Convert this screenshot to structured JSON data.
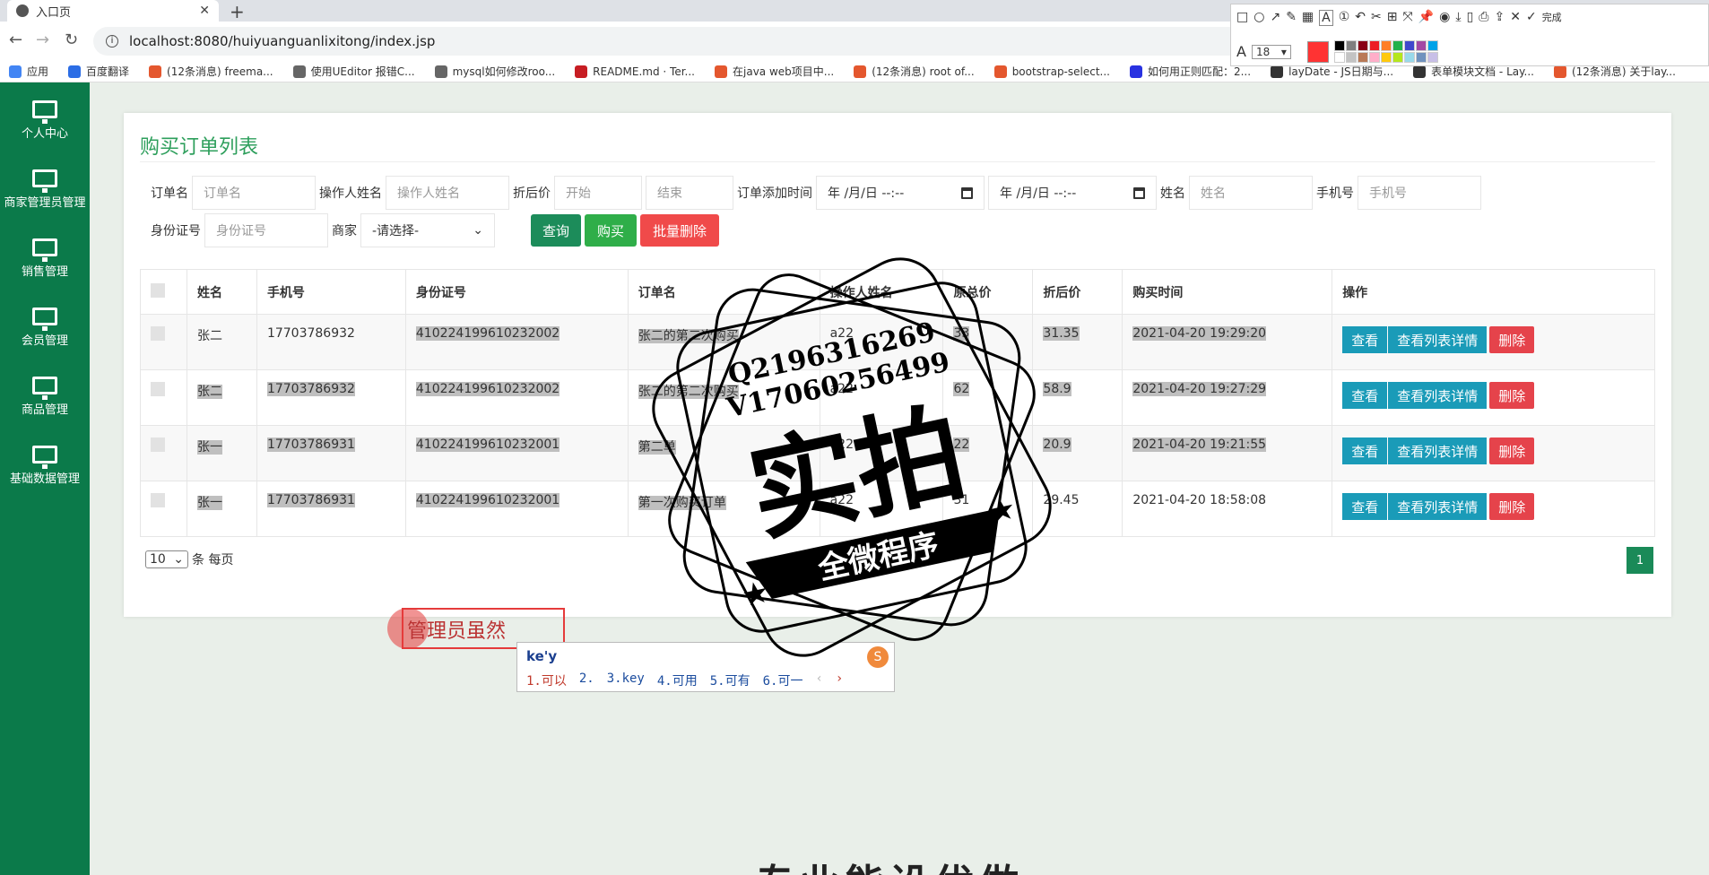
{
  "browser": {
    "tab_title": "入口页",
    "url": "localhost:8080/huiyuanguanlixitong/index.jsp",
    "bookmarks": [
      {
        "label": "应用",
        "color": "#4285f4"
      },
      {
        "label": "百度翻译",
        "color": "#2b6de5"
      },
      {
        "label": "(12条消息) freema...",
        "color": "#e4572e"
      },
      {
        "label": "使用UEditor 报错C...",
        "color": "#666666"
      },
      {
        "label": "mysql如何修改roo...",
        "color": "#666666"
      },
      {
        "label": "README.md · Ter...",
        "color": "#c71d23"
      },
      {
        "label": "在java web项目中...",
        "color": "#e4572e"
      },
      {
        "label": "(12条消息) root of...",
        "color": "#e4572e"
      },
      {
        "label": "bootstrap-select...",
        "color": "#e4572e"
      },
      {
        "label": "如何用正则匹配：2...",
        "color": "#2932e1"
      },
      {
        "label": "layDate - JS日期与...",
        "color": "#333333"
      },
      {
        "label": "表单模块文档 - Lay...",
        "color": "#333333"
      },
      {
        "label": "(12条消息) 关于lay...",
        "color": "#e4572e"
      }
    ]
  },
  "shot_tool": {
    "done_label": "完成",
    "font_size": "18",
    "swatches": [
      "#000000",
      "#7f7f7f",
      "#880015",
      "#ed1c24",
      "#ff7f27",
      "#22b14c",
      "#3f48cc",
      "#a349a4",
      "#00a2e8",
      "#ffffff",
      "#c3c3c3",
      "#b97a57",
      "#ffaec9",
      "#ffc90e",
      "#b5e61d",
      "#99d9ea",
      "#7092be",
      "#c8bfe7"
    ],
    "current_color": "#ff3333"
  },
  "sidebar": {
    "items": [
      {
        "label": "个人中心"
      },
      {
        "label": "商家管理员管理"
      },
      {
        "label": "销售管理"
      },
      {
        "label": "会员管理"
      },
      {
        "label": "商品管理"
      },
      {
        "label": "基础数据管理"
      }
    ]
  },
  "panel": {
    "title": "购买订单列表",
    "filters": {
      "order_name_label": "订单名",
      "order_name_ph": "订单名",
      "operator_label": "操作人姓名",
      "operator_ph": "操作人姓名",
      "discount_label": "折后价",
      "start_ph": "开始",
      "end_ph": "结束",
      "add_time_label": "订单添加时间",
      "date_ph": "年 /月/日 --:--",
      "name_label": "姓名",
      "name_ph": "姓名",
      "phone_label": "手机号",
      "phone_ph": "手机号",
      "idcard_label": "身份证号",
      "idcard_ph": "身份证号",
      "merchant_label": "商家",
      "merchant_value": "-请选择-"
    },
    "buttons": {
      "query": "查询",
      "buy": "购买",
      "batch_delete": "批量删除"
    },
    "table": {
      "headers": [
        "姓名",
        "手机号",
        "身份证号",
        "订单名",
        "操作人姓名",
        "原总价",
        "折后价",
        "购买时间",
        "操作"
      ],
      "rows": [
        {
          "name": "张二",
          "phone": "17703786932",
          "idcard": "410224199610232002",
          "order": "张二的第二次购买",
          "operator": "a22",
          "total": "33",
          "discount": "31.35",
          "time": "2021-04-20 19:29:20"
        },
        {
          "name": "张二",
          "phone": "17703786932",
          "idcard": "410224199610232002",
          "order": "张二的第二次购买",
          "operator": "a22",
          "total": "62",
          "discount": "58.9",
          "time": "2021-04-20 19:27:29"
        },
        {
          "name": "张一",
          "phone": "17703786931",
          "idcard": "410224199610232001",
          "order": "第二单",
          "operator": "a22",
          "total": "22",
          "discount": "20.9",
          "time": "2021-04-20 19:21:55"
        },
        {
          "name": "张一",
          "phone": "17703786931",
          "idcard": "410224199610232001",
          "order": "第一次购买订单",
          "operator": "a22",
          "total": "31",
          "discount": "29.45",
          "time": "2021-04-20 18:58:08"
        }
      ],
      "op_view": "查看",
      "op_detail": "查看列表详情",
      "op_delete": "删除"
    },
    "pager": {
      "page_size": "10",
      "per_page_label": "条 每页",
      "current_page": "1"
    }
  },
  "annotation": {
    "text": "管理员虽然"
  },
  "ime": {
    "input": "ke'y",
    "candidates": [
      "1.可以",
      "2.",
      "3.key",
      "4.可用",
      "5.可有",
      "6.可一"
    ],
    "logo": "S"
  },
  "watermark": {
    "line1": "Q2196316269",
    "line2": "V17060256499",
    "big": "实拍",
    "banner": "全微程序"
  },
  "bottom": {
    "text": "专业能设优做"
  }
}
